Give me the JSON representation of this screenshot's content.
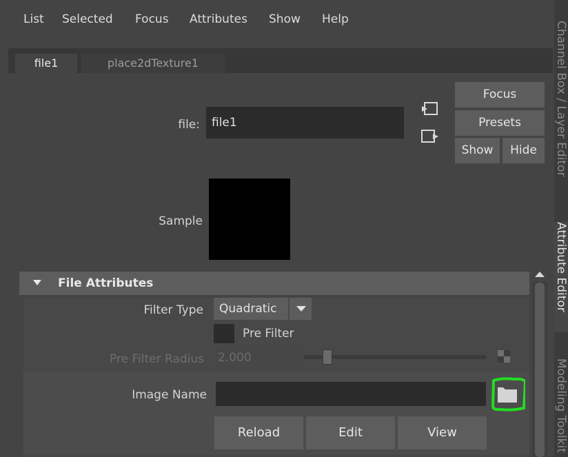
{
  "menu": {
    "items": [
      "List",
      "Selected",
      "Focus",
      "Attributes",
      "Show",
      "Help"
    ]
  },
  "tabs": {
    "active": "file1",
    "inactive": "place2dTexture1"
  },
  "node": {
    "label": "file:",
    "value": "file1"
  },
  "buttons": {
    "focus": "Focus",
    "presets": "Presets",
    "show": "Show",
    "hide": "Hide"
  },
  "sample": {
    "label": "Sample"
  },
  "section": {
    "title": "File Attributes"
  },
  "filter_type": {
    "label": "Filter Type",
    "value": "Quadratic"
  },
  "pre_filter": {
    "label": "Pre Filter",
    "checked": false
  },
  "pre_filter_radius": {
    "label": "Pre Filter Radius",
    "value": "2.000"
  },
  "image_name": {
    "label": "Image Name",
    "value": ""
  },
  "actions": {
    "reload": "Reload",
    "edit": "Edit",
    "view": "View"
  },
  "side_rail": {
    "channel_box": "Channel Box / Layer Editor",
    "attribute_editor": "Attribute Editor",
    "modeling_toolkit": "Modeling Toolkit"
  },
  "colors": {
    "highlight": "#22dd22"
  }
}
